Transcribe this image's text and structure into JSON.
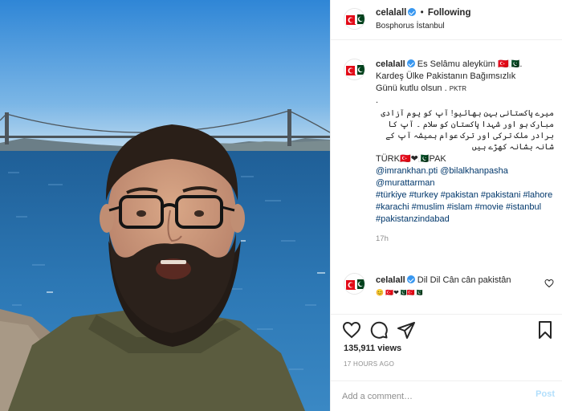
{
  "header": {
    "username": "celalall",
    "separator": "•",
    "follow_label": "Following",
    "location": "Bosphorus İstanbul"
  },
  "caption": {
    "username": "celalall",
    "line1": "Es Selâmu aleyküm 🇹🇷🇵🇰.",
    "line2": "Kardeş Ülke Pakistanın Bağımsızlık",
    "line3": "Günü kutlu olsun .",
    "flags_small": "PKTR",
    "dot": ".",
    "urdu": "میرے پاکستانی بہن بھائیو! آپ کو یوم آزادی مبارک ہو اور شہدا پاکستان کو سلام ۔ آپ کا برادر ملک ترکی اور ترک عوام ہمیشہ آپ کے شانہ بشانہ کھڑے ہیں",
    "turk_pak": "TÜRK🇹🇷❤🇵🇰PAK",
    "mention1": "@imrankhan.pti",
    "mention2": "@bilalkhanpasha",
    "mention3": "@murattarman",
    "tags": [
      "#türkiye",
      "#turkey",
      "#pakistan",
      "#pakistani",
      "#lahore",
      "#karachi",
      "#muslim",
      "#islam",
      "#movie",
      "#istanbul",
      "#pakistanzindabad"
    ],
    "time": "17h"
  },
  "comment": {
    "username": "celalall",
    "text": "Dil Dil Cân cân pakistân",
    "emoji_line": "😊 🇹🇷❤🇵🇰🇹🇷🇵🇰"
  },
  "stats": {
    "views": "135,911 views",
    "posted": "17 HOURS AGO"
  },
  "add_comment": {
    "placeholder": "Add a comment…",
    "post_label": "Post"
  },
  "icons": {
    "verified": "verified-badge-icon",
    "like": "heart-icon",
    "comment": "comment-icon",
    "share": "share-icon",
    "save": "bookmark-icon"
  },
  "colors": {
    "link": "#00376b",
    "verified": "#3897f0",
    "muted": "#8e8e8e",
    "post_disabled": "#b2dffc"
  }
}
